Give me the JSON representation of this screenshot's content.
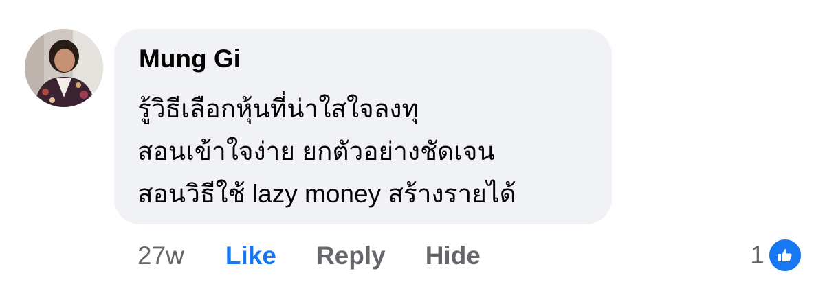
{
  "comment": {
    "author": "Mung Gi",
    "avatar_icon": "user-avatar-photo",
    "lines": [
      "รู้วิธีเลือกหุ้นที่น่าใสใจลงทุ",
      "สอนเข้าใจง่าย ยกตัวอย่างชัดเจน",
      "สอนวิธีใช้ lazy money สร้างรายได้"
    ],
    "bubble_color": "#f0f2f5",
    "actions": {
      "timestamp": "27w",
      "like_label": "Like",
      "reply_label": "Reply",
      "hide_label": "Hide"
    },
    "reactions": {
      "count": "1",
      "icon": "thumbs-up-icon",
      "color": "#1877f2"
    }
  }
}
